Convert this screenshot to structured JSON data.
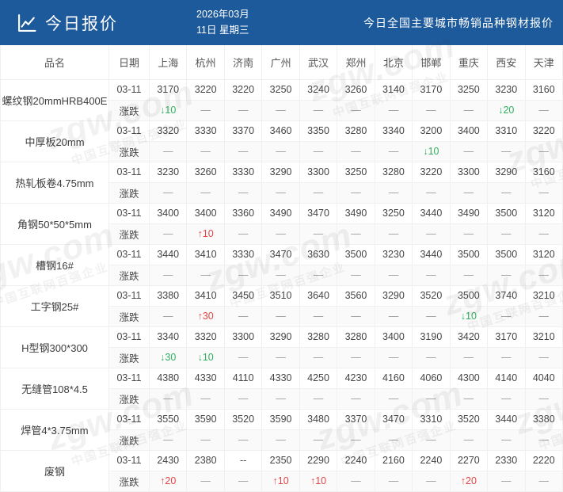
{
  "header": {
    "title": "今日报价",
    "date_line1": "2026年03月",
    "date_line2": "11日 星期三",
    "subtitle": "今日全国主要城市畅销品种钢材报价"
  },
  "watermark": {
    "brand": "zgw.com",
    "slogan": "中国互联网百强企业"
  },
  "colors": {
    "header_bg": "#1d5a9b",
    "up_red": "#e24646",
    "down_green": "#2fb05e"
  },
  "table": {
    "columns": [
      "品名",
      "日期",
      "上海",
      "杭州",
      "济南",
      "广州",
      "武汉",
      "郑州",
      "北京",
      "邯郸",
      "重庆",
      "西安",
      "天津"
    ],
    "products": [
      {
        "name": "螺纹钢20mmHRB400E",
        "date": "03-11",
        "change_label": "涨跌",
        "prices": [
          "3170",
          "3220",
          "3220",
          "3250",
          "3240",
          "3260",
          "3140",
          "3170",
          "3250",
          "3230",
          "3160"
        ],
        "changes": [
          "↓10",
          "—",
          "—",
          "—",
          "—",
          "—",
          "—",
          "—",
          "—",
          "↓20",
          "—"
        ]
      },
      {
        "name": "中厚板20mm",
        "date": "03-11",
        "change_label": "涨跌",
        "prices": [
          "3320",
          "3330",
          "3370",
          "3460",
          "3350",
          "3280",
          "3340",
          "3200",
          "3400",
          "3310",
          "3220"
        ],
        "changes": [
          "—",
          "—",
          "—",
          "—",
          "—",
          "—",
          "—",
          "↓10",
          "—",
          "—",
          "—"
        ]
      },
      {
        "name": "热轧板卷4.75mm",
        "date": "03-11",
        "change_label": "涨跌",
        "prices": [
          "3230",
          "3260",
          "3330",
          "3290",
          "3300",
          "3250",
          "3280",
          "3220",
          "3300",
          "3290",
          "3160"
        ],
        "changes": [
          "—",
          "—",
          "—",
          "—",
          "—",
          "—",
          "—",
          "—",
          "—",
          "—",
          "—"
        ]
      },
      {
        "name": "角钢50*50*5mm",
        "date": "03-11",
        "change_label": "涨跌",
        "prices": [
          "3400",
          "3400",
          "3360",
          "3490",
          "3470",
          "3490",
          "3250",
          "3440",
          "3490",
          "3500",
          "3120"
        ],
        "changes": [
          "—",
          "↑10",
          "—",
          "—",
          "—",
          "—",
          "—",
          "—",
          "—",
          "—",
          "—"
        ]
      },
      {
        "name": "槽钢16#",
        "date": "03-11",
        "change_label": "涨跌",
        "prices": [
          "3440",
          "3410",
          "3330",
          "3470",
          "3630",
          "3500",
          "3230",
          "3440",
          "3500",
          "3500",
          "3120"
        ],
        "changes": [
          "—",
          "—",
          "—",
          "—",
          "—",
          "—",
          "—",
          "—",
          "—",
          "—",
          "—"
        ]
      },
      {
        "name": "工字钢25#",
        "date": "03-11",
        "change_label": "涨跌",
        "prices": [
          "3380",
          "3410",
          "3450",
          "3510",
          "3640",
          "3560",
          "3290",
          "3520",
          "3500",
          "3740",
          "3210"
        ],
        "changes": [
          "—",
          "↑30",
          "—",
          "—",
          "—",
          "—",
          "—",
          "—",
          "↓10",
          "—",
          "—"
        ]
      },
      {
        "name": "H型钢300*300",
        "date": "03-11",
        "change_label": "涨跌",
        "prices": [
          "3340",
          "3320",
          "3300",
          "3290",
          "3280",
          "3280",
          "3400",
          "3190",
          "3420",
          "3170",
          "3210"
        ],
        "changes": [
          "↓30",
          "↓10",
          "—",
          "—",
          "—",
          "—",
          "—",
          "—",
          "—",
          "—",
          "—"
        ]
      },
      {
        "name": "无缝管108*4.5",
        "date": "03-11",
        "change_label": "涨跌",
        "prices": [
          "4380",
          "4330",
          "4110",
          "4330",
          "4250",
          "4230",
          "4160",
          "4060",
          "4300",
          "4140",
          "4040"
        ],
        "changes": [
          "—",
          "—",
          "—",
          "—",
          "—",
          "—",
          "—",
          "—",
          "—",
          "—",
          "—"
        ]
      },
      {
        "name": "焊管4*3.75mm",
        "date": "03-11",
        "change_label": "涨跌",
        "prices": [
          "3550",
          "3590",
          "3520",
          "3590",
          "3480",
          "3370",
          "3470",
          "3310",
          "3520",
          "3440",
          "3380"
        ],
        "changes": [
          "—",
          "—",
          "—",
          "—",
          "—",
          "—",
          "—",
          "—",
          "—",
          "—",
          "—"
        ]
      },
      {
        "name": "废钢",
        "date": "03-11",
        "change_label": "涨跌",
        "prices": [
          "2430",
          "2380",
          "--",
          "2350",
          "2290",
          "2240",
          "2160",
          "2240",
          "2270",
          "2330",
          "2220"
        ],
        "changes": [
          "↑20",
          "—",
          "—",
          "↑10",
          "↑10",
          "—",
          "—",
          "—",
          "↑20",
          "—",
          "—"
        ]
      }
    ]
  }
}
